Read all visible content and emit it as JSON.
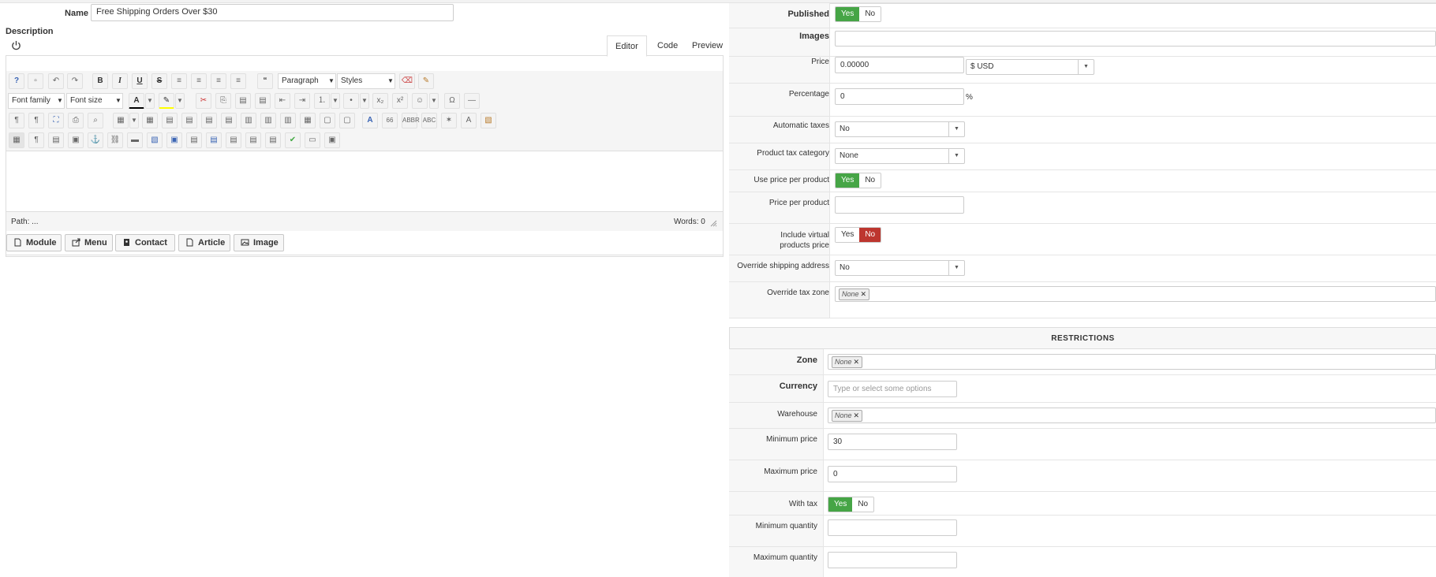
{
  "name_field": {
    "label": "Name",
    "value": "Free Shipping Orders Over $30"
  },
  "description": {
    "label": "Description"
  },
  "editor_tabs": [
    "Editor",
    "Code",
    "Preview"
  ],
  "toolbar": {
    "paragraph": "Paragraph",
    "styles": "Styles",
    "font_family": "Font family",
    "font_size": "Font size",
    "bold": "B",
    "italic": "I",
    "underline": "U",
    "strike": "S"
  },
  "status": {
    "path_label": "Path:",
    "path_value": "...",
    "words": "Words: 0"
  },
  "insert_buttons": [
    "Module",
    "Menu",
    "Contact",
    "Article",
    "Image"
  ],
  "fields": {
    "published": {
      "label": "Published",
      "yes": "Yes",
      "no": "No",
      "value": "Yes"
    },
    "images": {
      "label": "Images"
    },
    "price": {
      "label": "Price",
      "value": "0.00000",
      "currency": "$ USD"
    },
    "percentage": {
      "label": "Percentage",
      "value": "0",
      "unit": "%"
    },
    "automatic_taxes": {
      "label": "Automatic taxes",
      "value": "No"
    },
    "product_tax_category": {
      "label": "Product tax category",
      "value": "None"
    },
    "use_price_per_product": {
      "label": "Use price per product",
      "yes": "Yes",
      "no": "No",
      "value": "Yes"
    },
    "price_per_product": {
      "label": "Price per product",
      "value": ""
    },
    "include_virtual": {
      "label_line1": "Include virtual",
      "label_line2": "products price",
      "yes": "Yes",
      "no": "No",
      "value": "No"
    },
    "override_shipping": {
      "label": "Override shipping address",
      "value": "No"
    },
    "override_tax_zone": {
      "label": "Override tax zone",
      "chip": "None"
    }
  },
  "restrictions": {
    "title": "RESTRICTIONS",
    "zone": {
      "label": "Zone",
      "chip": "None"
    },
    "currency": {
      "label": "Currency",
      "placeholder": "Type or select some options"
    },
    "warehouse": {
      "label": "Warehouse",
      "chip": "None"
    },
    "minimum_price": {
      "label": "Minimum price",
      "value": "30"
    },
    "maximum_price": {
      "label": "Maximum price",
      "value": "0"
    },
    "with_tax": {
      "label": "With tax",
      "yes": "Yes",
      "no": "No",
      "value": "Yes"
    },
    "minimum_quantity": {
      "label": "Minimum quantity",
      "value": ""
    },
    "maximum_quantity": {
      "label": "Maximum quantity",
      "value": ""
    }
  },
  "colors": {
    "yes_active": "#46a546",
    "no_active": "#bd362f"
  }
}
